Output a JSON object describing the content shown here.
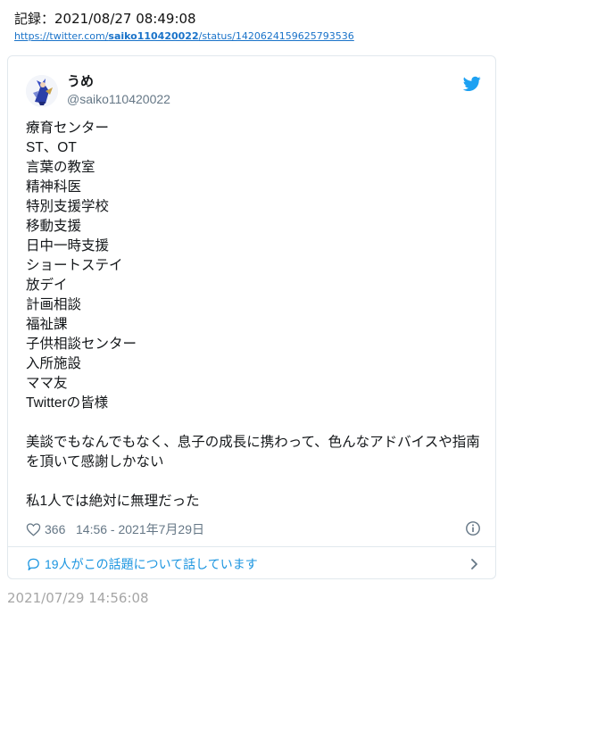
{
  "record": {
    "title": "記録：2021/08/27 08:49:08",
    "url_prefix": "https://twitter.com/",
    "url_user": "saiko110420022",
    "url_suffix": "/status/1420624159625793536"
  },
  "tweet": {
    "display_name": "うめ",
    "handle": "@saiko110420022",
    "lines": [
      "療育センター",
      "ST、OT",
      "言葉の教室",
      "精神科医",
      "特別支援学校",
      "移動支援",
      "日中一時支援",
      "ショートステイ",
      "放デイ",
      "計画相談",
      "福祉課",
      "子供相談センター",
      "入所施設",
      "ママ友",
      "Twitterの皆様",
      "",
      "美談でもなんでもなく、息子の成長に携わって、色んなアドバイスや指南を頂いて感謝しかない",
      "",
      "私1人では絶対に無理だった"
    ],
    "like_count": "366",
    "timestamp": "14:56 - 2021年7月29日",
    "conversation": "19人がこの話題について話しています"
  },
  "archived_time": "2021/07/29 14:56:08",
  "colors": {
    "link": "#1a73c9",
    "twitter_blue": "#1da1f2",
    "meta_gray": "#657786",
    "border": "#e1e8ed"
  },
  "icons": {
    "avatar": "avatar-illustration",
    "brand": "twitter-bird-icon",
    "like": "heart-icon",
    "info": "info-icon",
    "reply": "speech-bubble-icon",
    "chevron": "chevron-right-icon"
  }
}
